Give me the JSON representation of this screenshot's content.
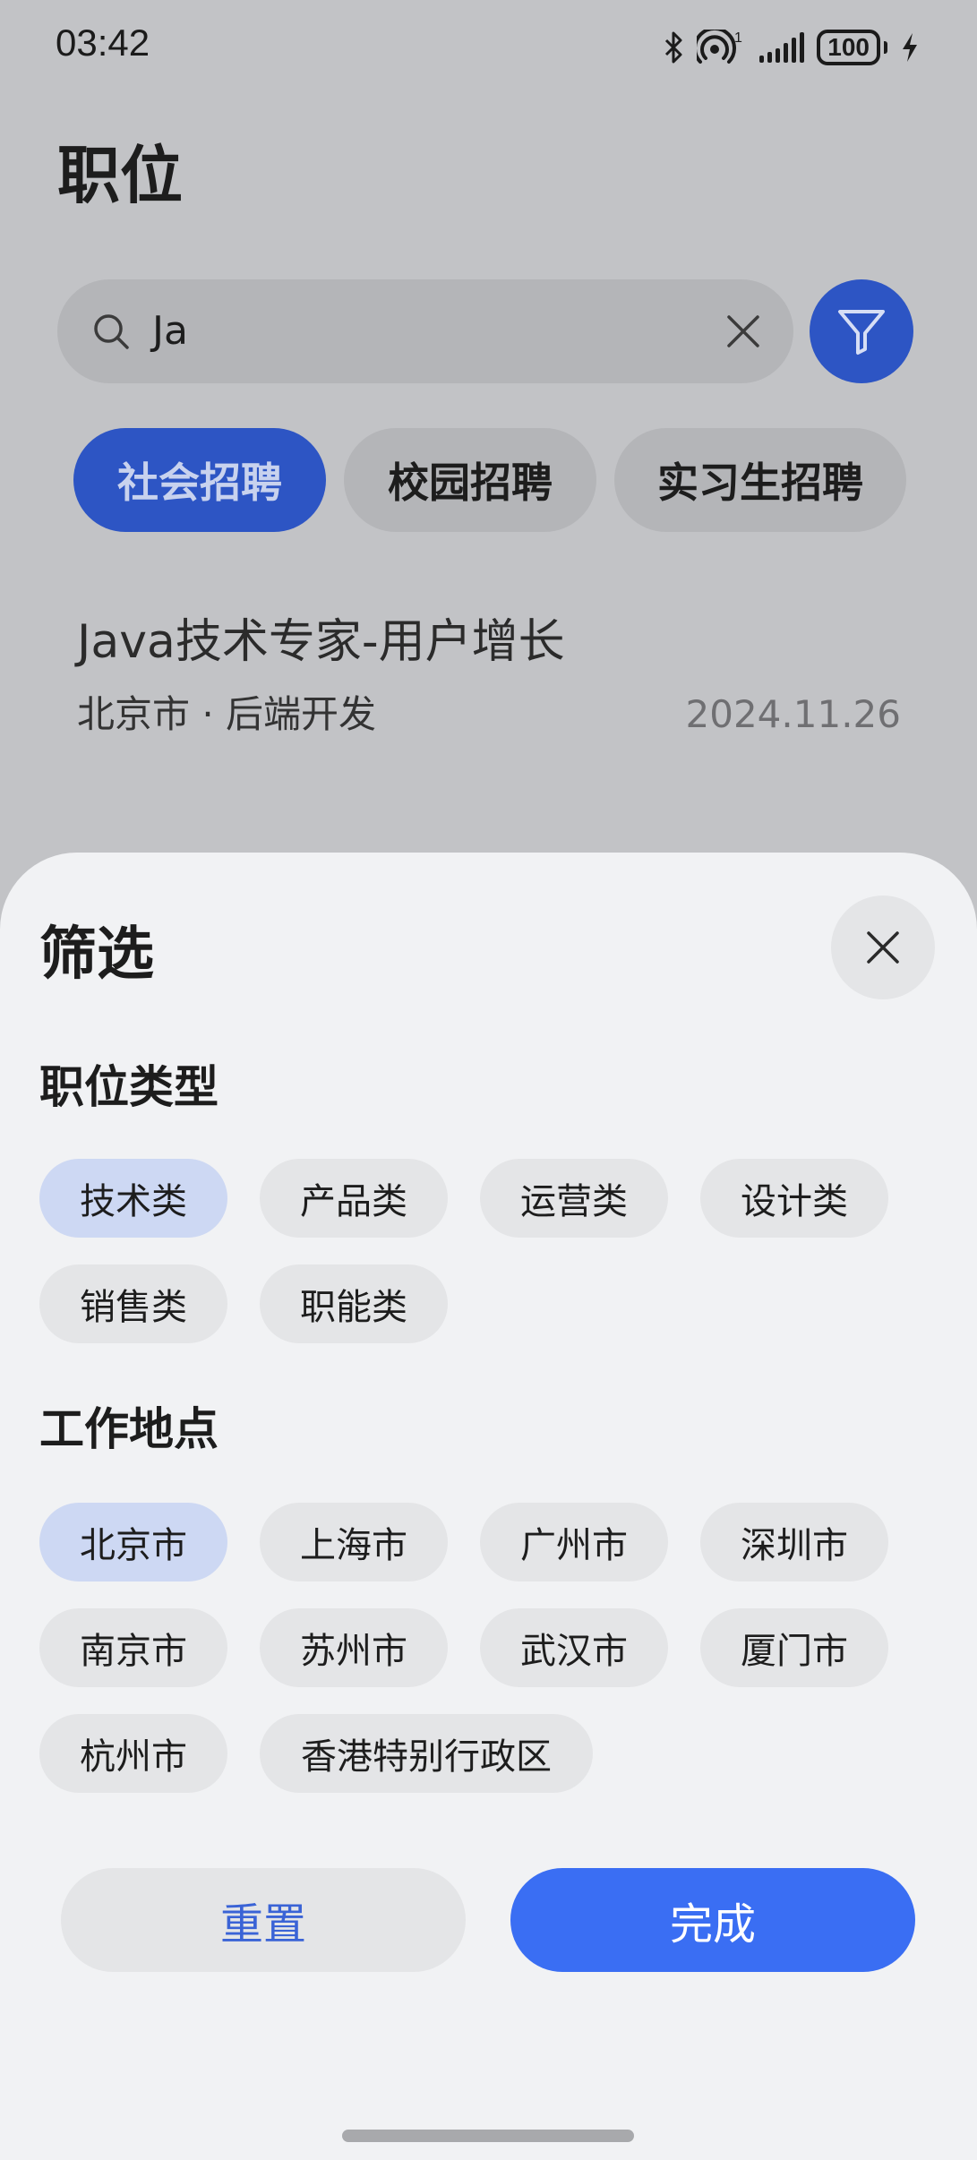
{
  "status_bar": {
    "time": "03:42",
    "signal_sup": "1",
    "battery": "100"
  },
  "page": {
    "title": "职位"
  },
  "search": {
    "value": "Ja"
  },
  "tabs": [
    {
      "label": "社会招聘",
      "active": true
    },
    {
      "label": "校园招聘",
      "active": false
    },
    {
      "label": "实习生招聘",
      "active": false
    }
  ],
  "job": {
    "title": "Java技术专家-用户增长",
    "location_category": "北京市 · 后端开发",
    "date": "2024.11.26"
  },
  "filter_sheet": {
    "title": "筛选",
    "job_type": {
      "title": "职位类型",
      "options": [
        "技术类",
        "产品类",
        "运营类",
        "设计类",
        "销售类",
        "职能类"
      ],
      "selected": "技术类"
    },
    "work_location": {
      "title": "工作地点",
      "options": [
        "北京市",
        "上海市",
        "广州市",
        "深圳市",
        "南京市",
        "苏州市",
        "武汉市",
        "厦门市",
        "杭州市",
        "香港特别行政区"
      ],
      "selected": "北京市"
    },
    "reset_label": "重置",
    "done_label": "完成"
  },
  "colors": {
    "accent": "#3a6ef3",
    "accent_dim": "#2d55c4",
    "chip_selected": "#cdd8f3",
    "sheet_bg": "#f1f2f4"
  }
}
